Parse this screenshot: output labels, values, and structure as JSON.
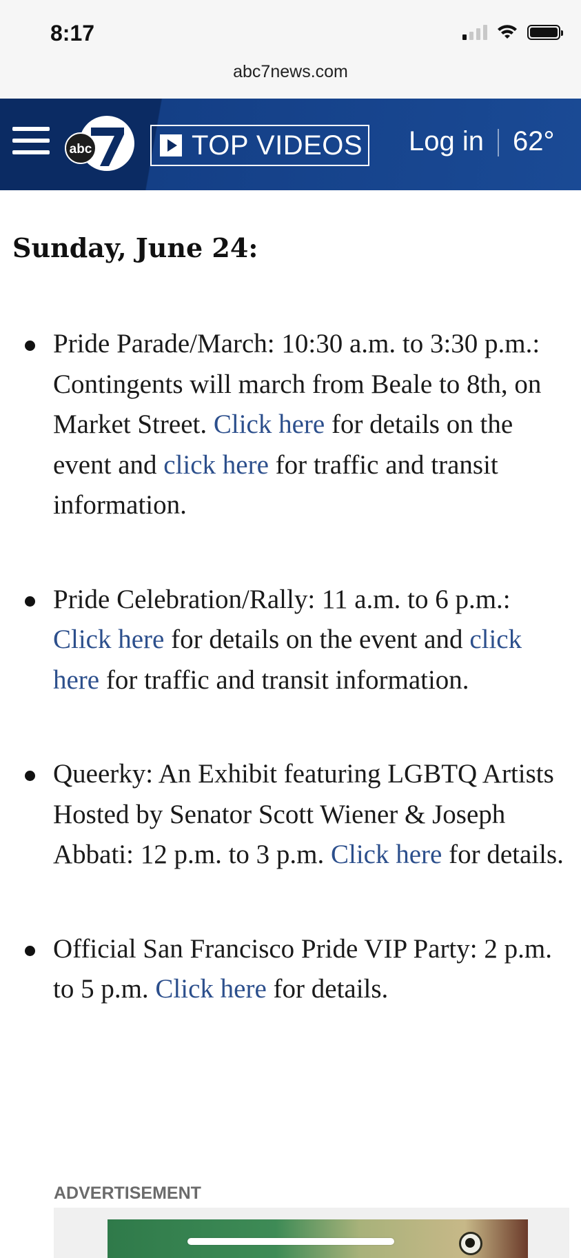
{
  "status_bar": {
    "time": "8:17",
    "url": "abc7news.com"
  },
  "header": {
    "logo_text": "abc",
    "logo_number": "7",
    "top_videos_label": "TOP VIDEOS",
    "login_label": "Log in",
    "temperature": "62°",
    "colors": {
      "header_bg": "#0b2b63",
      "accent": "#1a4a95"
    }
  },
  "article": {
    "heading": "Sunday, June 24:",
    "link_color": "#2c4f8c",
    "events": [
      {
        "text_1": "Pride Parade/March: 10:30 a.m. to 3:30 p.m.: Contingents will march from Beale to 8th, on Market Street. ",
        "link_1": "Click here",
        "text_2": " for details on the event and ",
        "link_2": "click here",
        "text_3": " for traffic and transit information."
      },
      {
        "text_1": "Pride Celebration/Rally: 11 a.m. to 6 p.m.: ",
        "link_1": "Click here",
        "text_2": " for details on the event and ",
        "link_2": "click here",
        "text_3": " for traffic and transit information."
      },
      {
        "text_1": "Queerky: An Exhibit featuring LGBTQ Artists Hosted by Senator Scott Wiener & Joseph Abbati: 12 p.m. to 3 p.m. ",
        "link_1": "Click here",
        "text_2": " for details."
      },
      {
        "text_1": "Official San Francisco Pride VIP Party: 2 p.m. to 5 p.m. ",
        "link_1": "Click here",
        "text_2": " for details."
      }
    ]
  },
  "advertisement": {
    "label": "ADVERTISEMENT"
  }
}
